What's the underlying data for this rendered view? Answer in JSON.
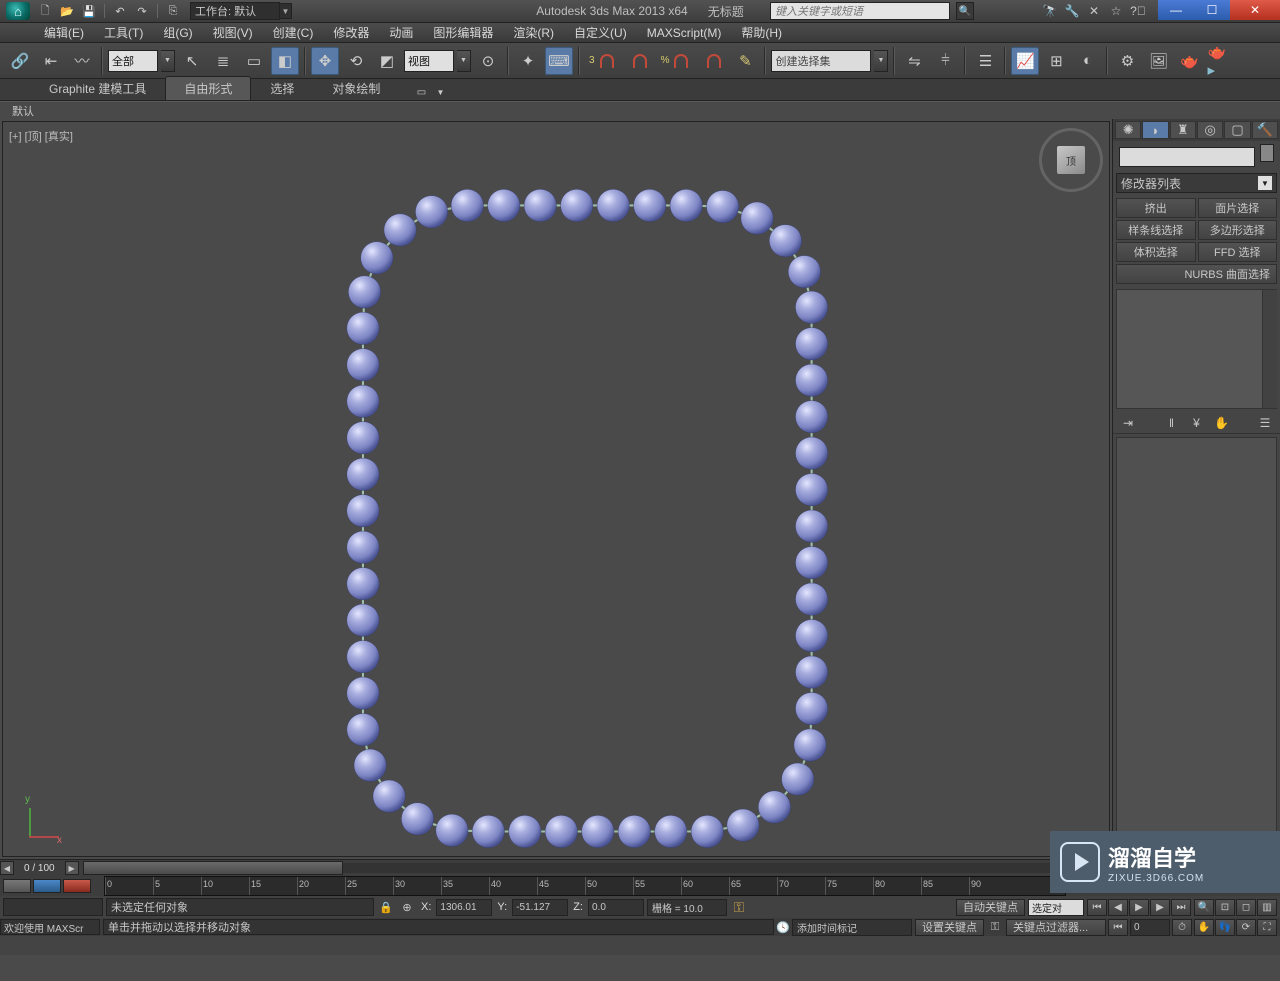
{
  "title_bar": {
    "workspace_label": "工作台: 默认",
    "app_name": "Autodesk 3ds Max  2013 x64",
    "doc_name": "无标题",
    "search_placeholder": "键入关键字或短语"
  },
  "menu": {
    "edit": "编辑(E)",
    "tools": "工具(T)",
    "group": "组(G)",
    "views": "视图(V)",
    "create": "创建(C)",
    "modifiers": "修改器",
    "animation": "动画",
    "graph": "图形编辑器",
    "render": "渲染(R)",
    "customize": "自定义(U)",
    "maxscript": "MAXScript(M)",
    "help": "帮助(H)"
  },
  "toolbar": {
    "filter_combo": "全部",
    "view_combo": "视图",
    "named_sel": "创建选择集"
  },
  "ribbon": {
    "tab_graphite": "Graphite 建模工具",
    "tab_freeform": "自由形式",
    "tab_select": "选择",
    "tab_paint": "对象绘制",
    "panel_default": "默认"
  },
  "viewport": {
    "label": "[+] [顶] [真实]",
    "viewcube_face": "顶",
    "axis_x": "x",
    "axis_y": "y"
  },
  "command_panel": {
    "mod_list": "修改器列表",
    "buttons": {
      "extrude": "挤出",
      "face_sel": "面片选择",
      "spline_sel": "样条线选择",
      "poly_sel": "多边形选择",
      "vol_sel": "体积选择",
      "ffd_sel": "FFD 选择",
      "nurbs_sel": "NURBS 曲面选择"
    }
  },
  "timeline": {
    "frame": "0 / 100",
    "ticks": [
      0,
      5,
      10,
      15,
      20,
      25,
      30,
      35,
      40,
      45,
      50,
      55,
      60,
      65,
      70,
      75,
      80,
      85,
      90
    ]
  },
  "status": {
    "no_selection": "未选定任何对象",
    "x_label": "X:",
    "x_val": "1306.01",
    "y_label": "Y:",
    "y_val": "-51.127",
    "z_label": "Z:",
    "z_val": "0.0",
    "grid": "栅格 = 10.0",
    "auto_key": "自动关键点",
    "set_key": "设置关键点",
    "selected": "选定对",
    "key_filter": "关键点过滤器...",
    "frame_field": "0",
    "add_tag": "添加时间标记",
    "welcome": "欢迎使用  MAXScr",
    "prompt": "单击并拖动以选择并移动对象"
  },
  "watermark": {
    "cn": "溜溜自学",
    "en": "ZIXUE.3D66.COM"
  }
}
